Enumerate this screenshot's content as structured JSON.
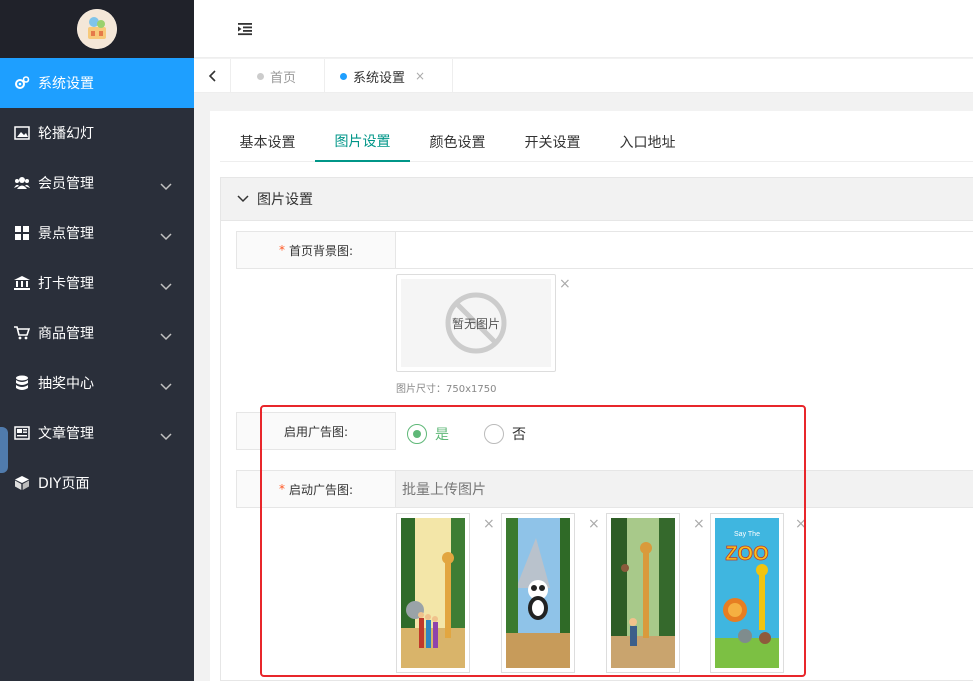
{
  "sidebar": {
    "items": [
      {
        "label": "系统设置",
        "icon": "gears-icon",
        "active": true,
        "chevron": false
      },
      {
        "label": "轮播幻灯",
        "icon": "image-icon",
        "active": false,
        "chevron": false
      },
      {
        "label": "会员管理",
        "icon": "users-icon",
        "active": false,
        "chevron": true
      },
      {
        "label": "景点管理",
        "icon": "grid-icon",
        "active": false,
        "chevron": true
      },
      {
        "label": "打卡管理",
        "icon": "bank-icon",
        "active": false,
        "chevron": true
      },
      {
        "label": "商品管理",
        "icon": "cart-icon",
        "active": false,
        "chevron": true
      },
      {
        "label": "抽奖中心",
        "icon": "database-icon",
        "active": false,
        "chevron": true
      },
      {
        "label": "文章管理",
        "icon": "newspaper-icon",
        "active": false,
        "chevron": true
      },
      {
        "label": "DIY页面",
        "icon": "cube-icon",
        "active": false,
        "chevron": false
      }
    ]
  },
  "tabs": {
    "home": "首页",
    "current": "系统设置",
    "close": "×"
  },
  "subtabs": [
    "基本设置",
    "图片设置",
    "颜色设置",
    "开关设置",
    "入口地址"
  ],
  "subtab_active": 1,
  "section": {
    "title": "图片设置"
  },
  "form": {
    "home_bg": {
      "required": "*",
      "label": "首页背景图:",
      "empty_text": "暂无图片",
      "size_hint": "图片尺寸：750x1750",
      "delete": "×"
    },
    "ad_enable": {
      "label": "启用广告图:",
      "yes": "是",
      "no": "否",
      "selected": "是"
    },
    "ad_images": {
      "required": "*",
      "label": "启动广告图:",
      "upload_text": "批量上传图片",
      "delete": "×",
      "thumbs": [
        {
          "name": "family-giraffe-thumb"
        },
        {
          "name": "panda-jungle-thumb"
        },
        {
          "name": "giraffe-forest-thumb"
        },
        {
          "name": "zoo-poster-thumb",
          "poster_text": "ZOO",
          "poster_small": "Say The"
        }
      ]
    }
  },
  "colors": {
    "sidebar_bg": "#2a2f3a",
    "active_blue": "#1e9fff",
    "accent_teal": "#009688",
    "radio_green": "#5fb878",
    "highlight_red": "#e8262b"
  }
}
